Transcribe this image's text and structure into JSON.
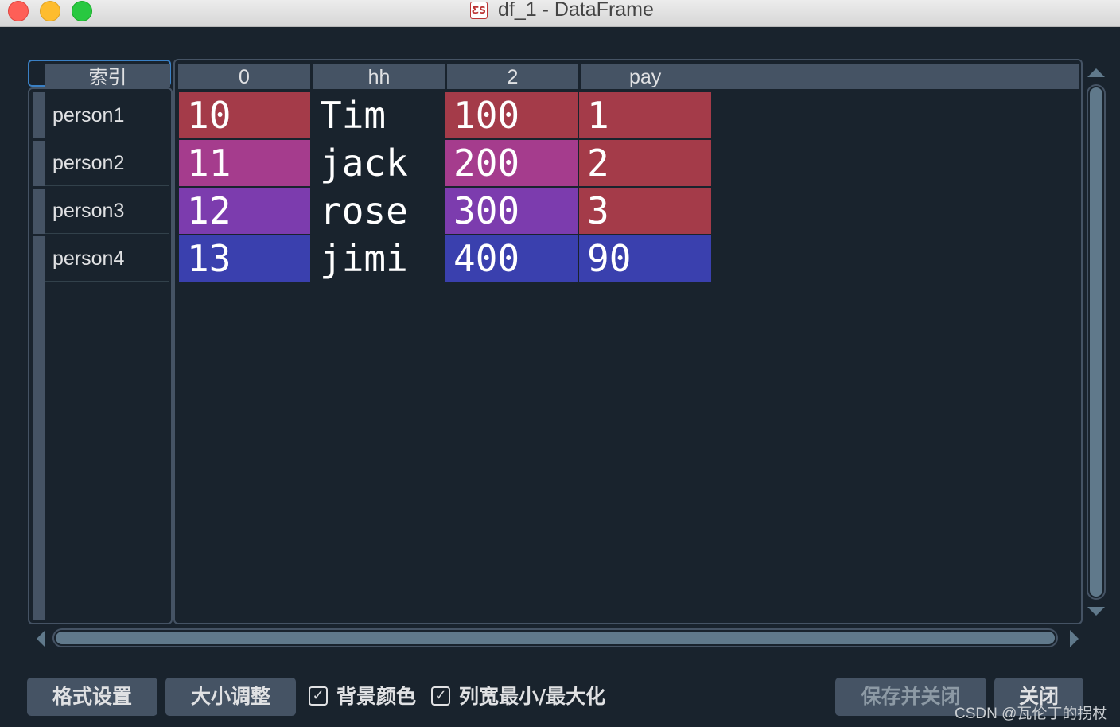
{
  "window": {
    "title": "df_1 - DataFrame",
    "app_icon_text": "ƸS"
  },
  "index": {
    "header": "索引",
    "rows": [
      "person1",
      "person2",
      "person3",
      "person4"
    ]
  },
  "columns": [
    "0",
    "hh",
    "2",
    "pay"
  ],
  "cells": [
    [
      {
        "text": "10",
        "bg": "#a43b49"
      },
      {
        "text": "Tim",
        "bg": "#19232d"
      },
      {
        "text": "100",
        "bg": "#a43b49"
      },
      {
        "text": "1",
        "bg": "#a43b49"
      }
    ],
    [
      {
        "text": "11",
        "bg": "#a53c8d"
      },
      {
        "text": "jack",
        "bg": "#19232d"
      },
      {
        "text": "200",
        "bg": "#a53c8d"
      },
      {
        "text": "2",
        "bg": "#a43b49"
      }
    ],
    [
      {
        "text": "12",
        "bg": "#7c3cae"
      },
      {
        "text": "rose",
        "bg": "#19232d"
      },
      {
        "text": "300",
        "bg": "#7c3cae"
      },
      {
        "text": "3",
        "bg": "#a43b49"
      }
    ],
    [
      {
        "text": "13",
        "bg": "#3a40ae"
      },
      {
        "text": "jimi",
        "bg": "#19232d"
      },
      {
        "text": "400",
        "bg": "#3a40ae"
      },
      {
        "text": "90",
        "bg": "#3a40ae"
      }
    ]
  ],
  "buttons": {
    "format": "格式设置",
    "resize": "大小调整",
    "save_close": "保存并关闭",
    "close": "关闭"
  },
  "checkboxes": {
    "bg_color": {
      "label": "背景颜色",
      "checked": true
    },
    "col_width": {
      "label": "列宽最小/最大化",
      "checked": true
    }
  },
  "check_mark": "✓",
  "watermark": "CSDN @瓦伦丁的拐杖",
  "colors": {
    "background": "#19232d",
    "header": "#455364",
    "scroll": "#60798b",
    "focus": "#3a80c4"
  }
}
